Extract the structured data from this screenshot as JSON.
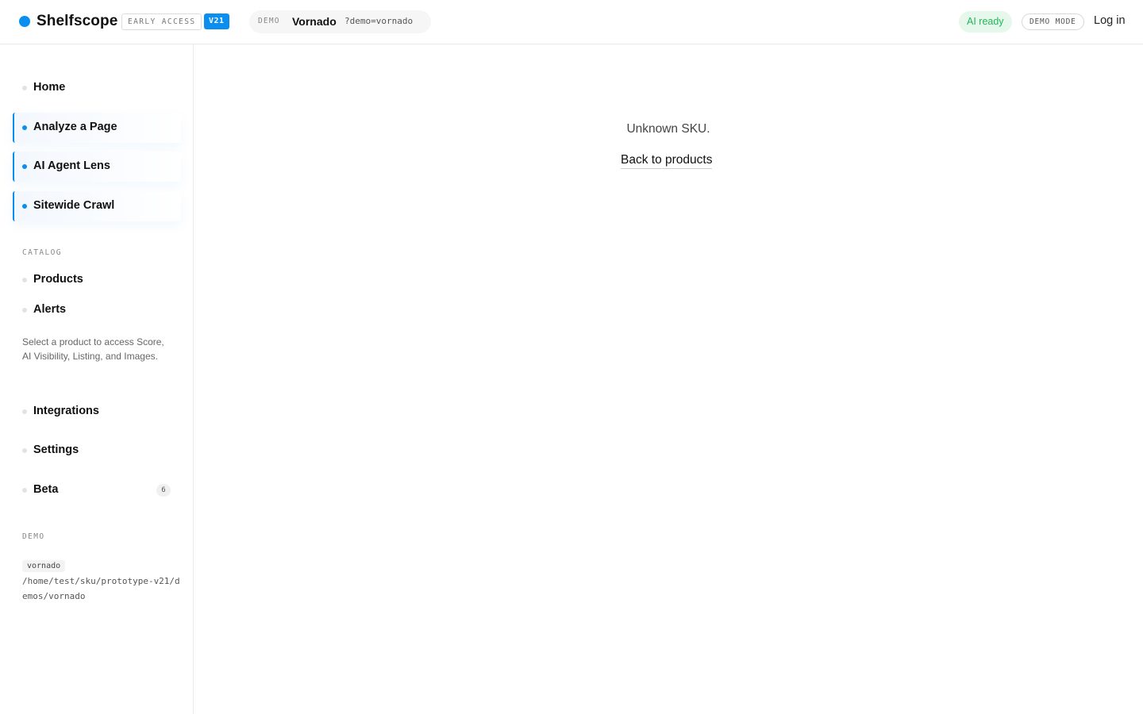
{
  "header": {
    "brand": "Shelfscope",
    "early_access": "EARLY ACCESS",
    "version": "V21",
    "demo_tag": "DEMO",
    "demo_name": "Vornado",
    "demo_query": "?demo=vornado",
    "ai_status": "AI ready",
    "mode": "DEMO MODE",
    "login": "Log in"
  },
  "sidebar": {
    "items": [
      {
        "label": "Home",
        "active": false
      },
      {
        "label": "Analyze a Page",
        "active": true
      },
      {
        "label": "AI Agent Lens",
        "active": true
      },
      {
        "label": "Sitewide Crawl",
        "active": true
      }
    ],
    "catalog_heading": "CATALOG",
    "catalog_items": [
      {
        "label": "Products"
      },
      {
        "label": "Alerts"
      }
    ],
    "hint": "Select a product to access Score, AI Visibility, Listing, and Images.",
    "bottom_items": [
      {
        "label": "Integrations"
      },
      {
        "label": "Settings"
      },
      {
        "label": "Beta",
        "count": "6"
      }
    ],
    "demo_heading": "DEMO",
    "demo_chip": "vornado",
    "demo_path": "/home/test/sku/prototype-v21/demos/vornado"
  },
  "main": {
    "message": "Unknown SKU.",
    "back_link": "Back to products"
  },
  "colors": {
    "accent": "#0a8ef0",
    "ai_ready_text": "#22b55a",
    "ai_ready_bg": "#e6f8ec"
  }
}
